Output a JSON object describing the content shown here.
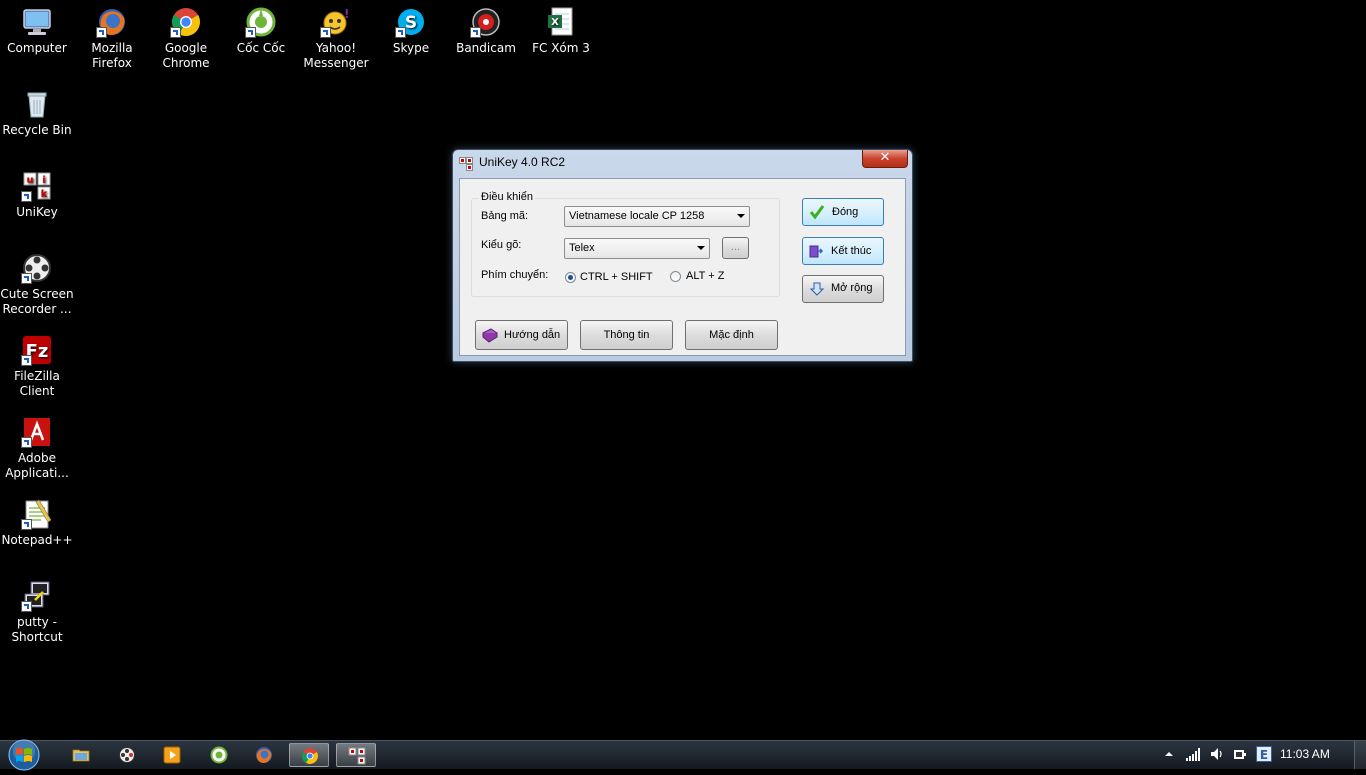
{
  "desktop": {
    "icons": [
      {
        "label": "Computer",
        "icon": "computer-icon"
      },
      {
        "label": "Mozilla Firefox",
        "icon": "firefox-icon"
      },
      {
        "label": "Google Chrome",
        "icon": "chrome-icon"
      },
      {
        "label": "Cốc Cốc",
        "icon": "coccoc-icon"
      },
      {
        "label": "Yahoo! Messenger",
        "icon": "yahoo-messenger-icon"
      },
      {
        "label": "Skype",
        "icon": "skype-icon"
      },
      {
        "label": "Bandicam",
        "icon": "bandicam-icon"
      },
      {
        "label": "FC Xóm 3",
        "icon": "excel-file-icon"
      },
      {
        "label": "Recycle Bin",
        "icon": "recycle-bin-icon"
      },
      {
        "label": "UniKey",
        "icon": "unikey-icon"
      },
      {
        "label": "Cute Screen Recorder ...",
        "icon": "cute-screen-recorder-icon"
      },
      {
        "label": "FileZilla Client",
        "icon": "filezilla-icon"
      },
      {
        "label": "Adobe Applicati...",
        "icon": "adobe-icon"
      },
      {
        "label": "Notepad++",
        "icon": "notepadpp-icon"
      },
      {
        "label": "putty - Shortcut",
        "icon": "putty-icon"
      }
    ]
  },
  "unikey": {
    "title": "UniKey 4.0 RC2",
    "close_glyph": "✕",
    "group_label": "Điều khiển",
    "charset_label": "Bảng mã:",
    "charset_value": "Vietnamese locale CP 1258",
    "input_method_label": "Kiểu gõ:",
    "input_method_value": "Telex",
    "more_button": "...",
    "hotkey_label": "Phím chuyển:",
    "hotkey_options": [
      {
        "label": "CTRL + SHIFT",
        "checked": true
      },
      {
        "label": "ALT + Z",
        "checked": false
      }
    ],
    "buttons": {
      "close": "Đóng",
      "exit": "Kết thúc",
      "expand": "Mở rộng",
      "help": "Hướng dẫn",
      "info": "Thông tin",
      "default": "Mặc định"
    }
  },
  "taskbar": {
    "pinned": [
      {
        "name": "explorer",
        "icon": "folder-icon"
      },
      {
        "name": "cute-screen-recorder",
        "icon": "recorder-icon"
      },
      {
        "name": "media-player",
        "icon": "media-player-icon"
      },
      {
        "name": "coccoc",
        "icon": "coccoc-icon"
      },
      {
        "name": "firefox",
        "icon": "firefox-icon"
      },
      {
        "name": "chrome",
        "icon": "chrome-icon"
      },
      {
        "name": "unikey",
        "icon": "unikey-icon"
      }
    ],
    "clock": "11:03 AM"
  },
  "colors": {
    "accent_blue": "#3c7fb1",
    "close_red": "#c9432d",
    "desktop_bg": "#000000"
  }
}
